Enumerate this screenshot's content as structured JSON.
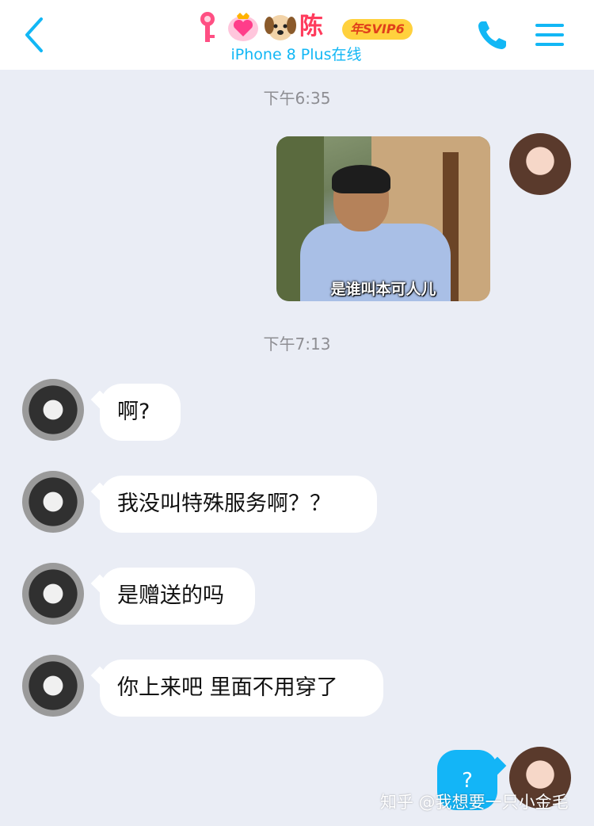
{
  "header": {
    "name": "陈",
    "badge": "年SVIP6",
    "status": "iPhone 8 Plus在线",
    "accent_color": "#12b7f5"
  },
  "timestamps": [
    "下午6:35",
    "下午7:13"
  ],
  "image_message": {
    "caption": "是谁叫本可人儿"
  },
  "incoming_messages": [
    {
      "text": "啊?"
    },
    {
      "text": "我没叫特殊服务啊？？"
    },
    {
      "text": "是赠送的吗"
    },
    {
      "text": "你上来吧 里面不用穿了"
    }
  ],
  "outgoing_message": {
    "text": "?"
  },
  "watermark": "知乎 @我想要一只小金毛",
  "icons": {
    "back": "chevron-left-icon",
    "call": "phone-icon",
    "menu": "menu-icon"
  }
}
